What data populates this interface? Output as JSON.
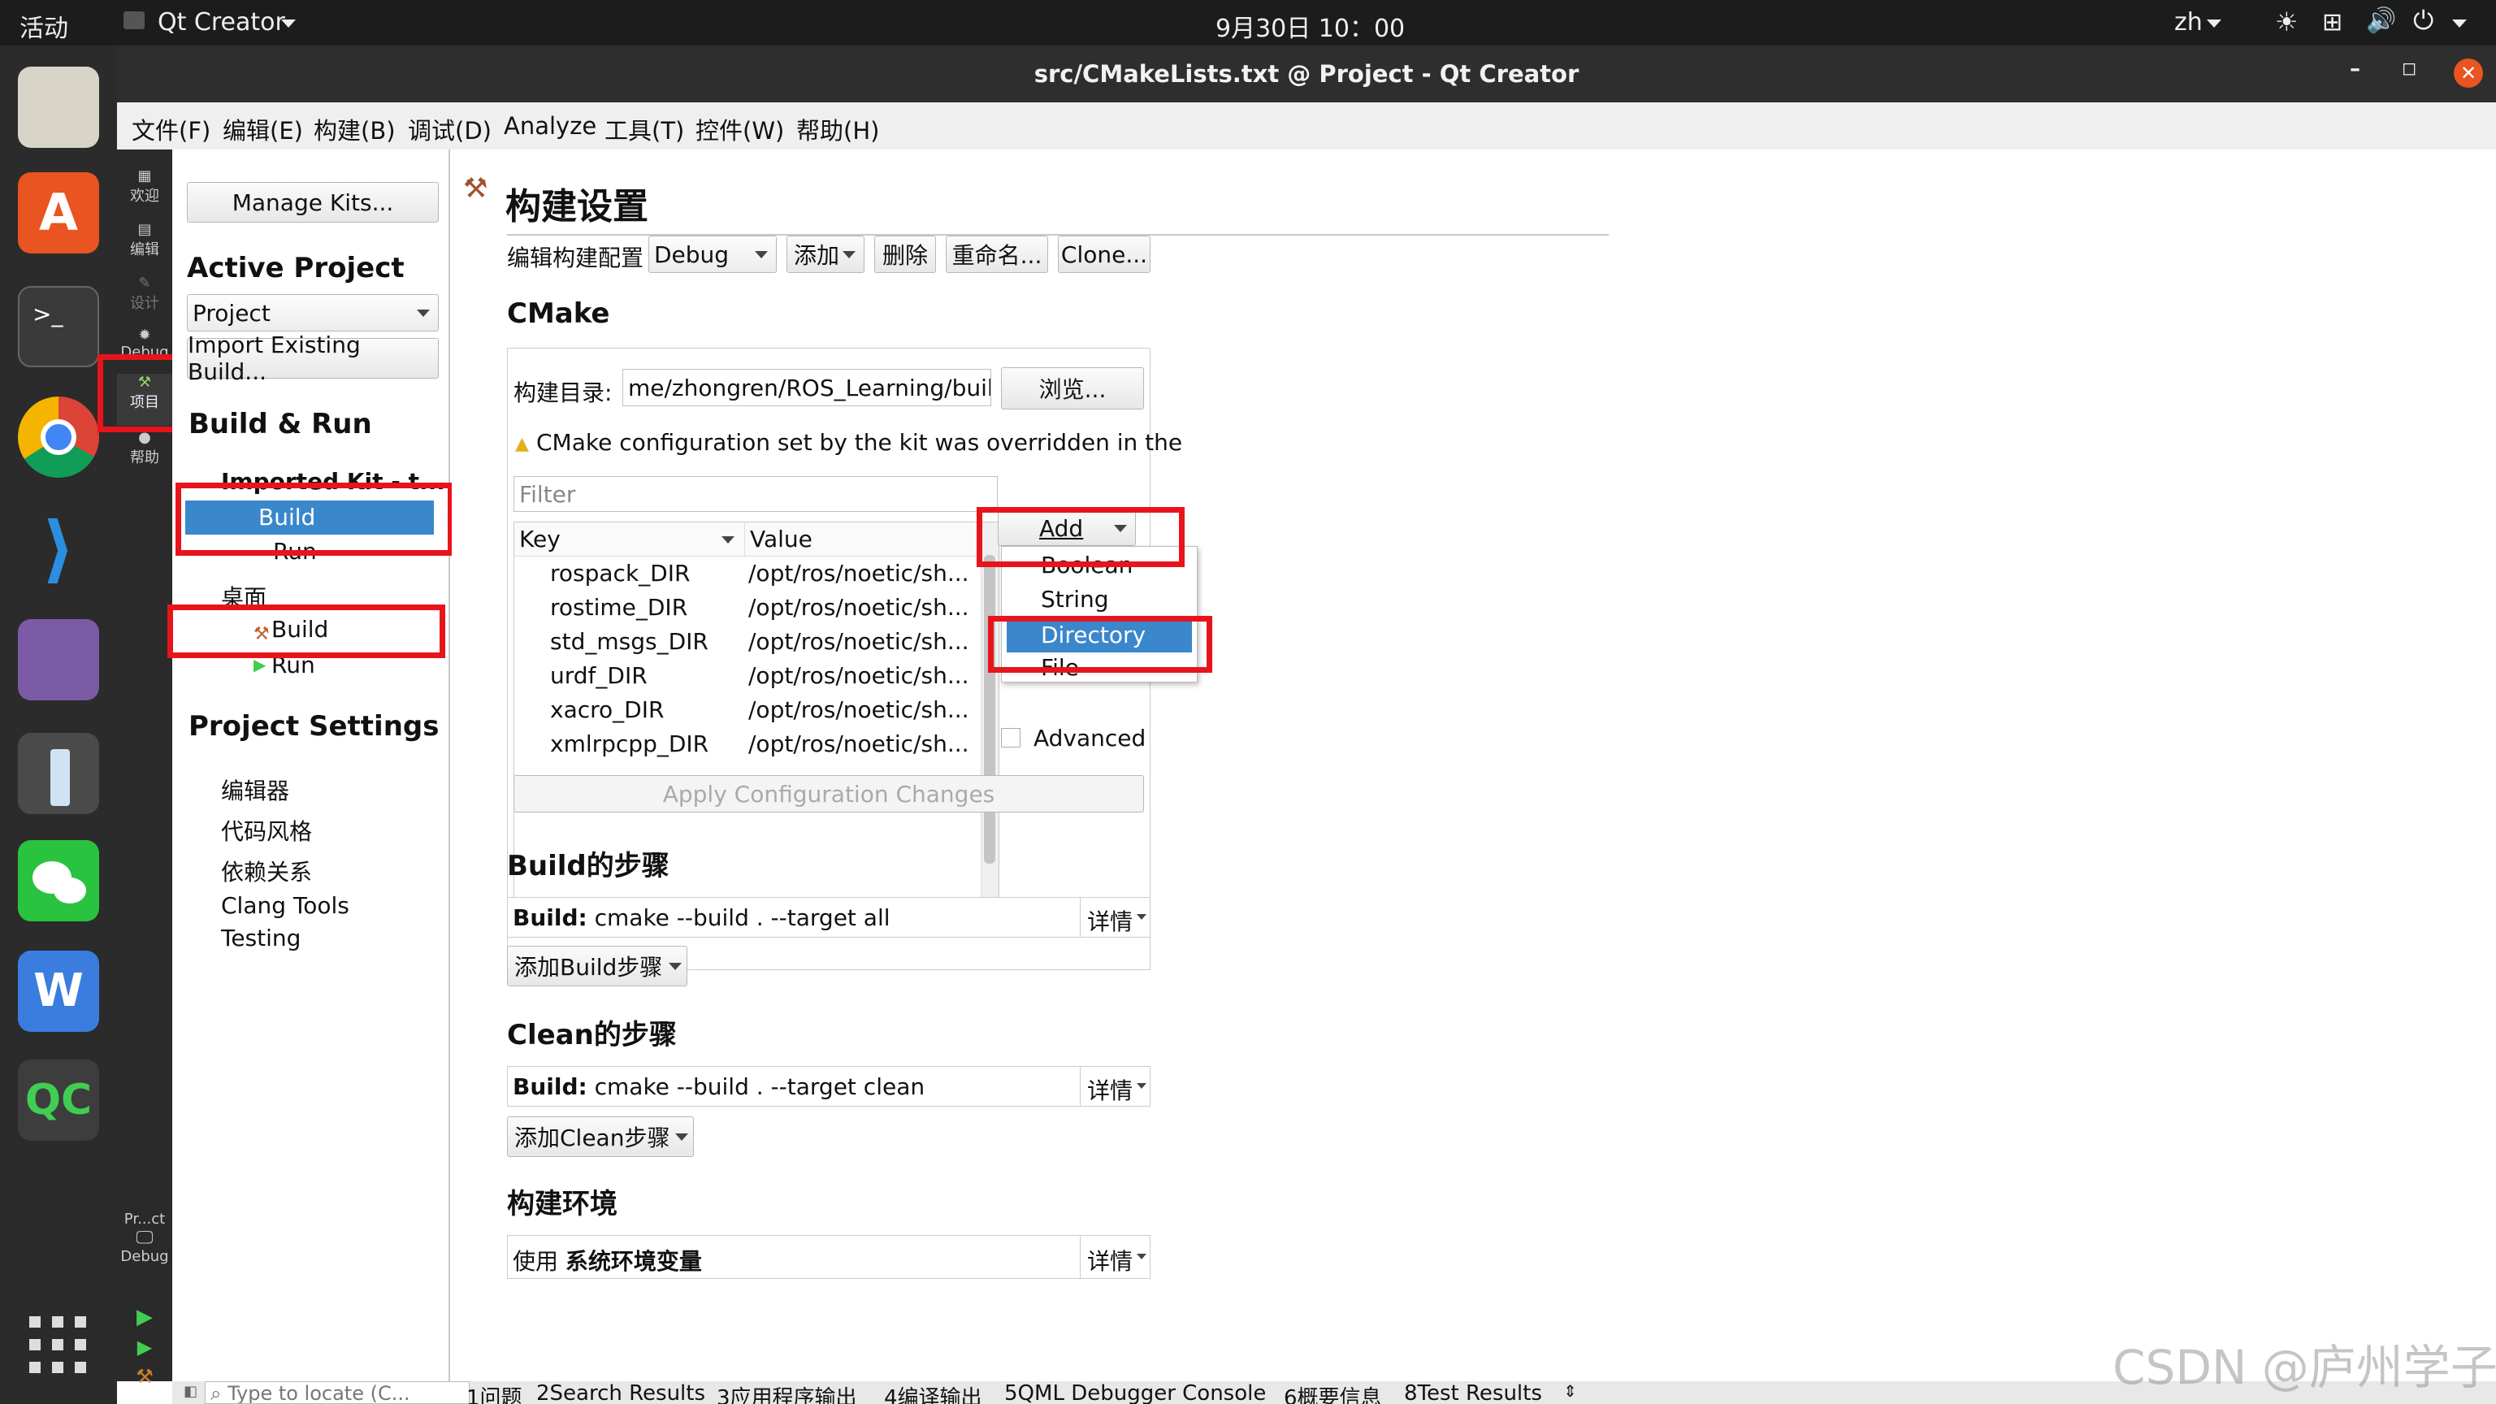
{
  "topbar": {
    "activities": "活动",
    "app_name": "Qt Creator",
    "clock": "9月30日 10：00",
    "lang": "zh"
  },
  "window": {
    "title": "src/CMakeLists.txt @ Project - Qt Creator"
  },
  "menu": [
    "文件(F)",
    "编辑(E)",
    "构建(B)",
    "调试(D)",
    "Analyze",
    "工具(T)",
    "控件(W)",
    "帮助(H)"
  ],
  "modes": {
    "welcome": "欢迎",
    "edit": "编辑",
    "design": "设计",
    "debug": "Debug",
    "projects": "项目",
    "help": "帮助",
    "kit_project": "Pr...ct",
    "kit_config": "Debug"
  },
  "left": {
    "manage_kits": "Manage Kits...",
    "active_project_heading": "Active Project",
    "project_select": "Project",
    "import_build": "Import Existing Build...",
    "build_run_heading": "Build & Run",
    "kit1_name": "Imported Kit - t...",
    "kit1_build": "Build",
    "kit1_run": "Run",
    "kit2_name": "桌面",
    "kit2_build": "Build",
    "kit2_run": "Run",
    "project_settings_heading": "Project Settings",
    "settings_items": [
      "编辑器",
      "代码风格",
      "依赖关系",
      "Clang Tools",
      "Testing"
    ]
  },
  "main": {
    "page_title": "构建设置",
    "edit_config_label": "编辑构建配置",
    "config_value": "Debug",
    "add_label": "添加",
    "delete_label": "删除",
    "rename_label": "重命名...",
    "clone_label": "Clone...",
    "cmake_heading": "CMake",
    "build_dir_label": "构建目录:",
    "build_dir_value": "me/zhongren/ROS_Learning/build",
    "browse_label": "浏览...",
    "warning_text": "CMake configuration set by the kit was overridden in the",
    "filter_placeholder": "Filter",
    "table_headers": {
      "key": "Key",
      "value": "Value"
    },
    "table_rows": [
      {
        "key": "rospack_DIR",
        "value": "/opt/ros/noetic/sh..."
      },
      {
        "key": "rostime_DIR",
        "value": "/opt/ros/noetic/sh..."
      },
      {
        "key": "std_msgs_DIR",
        "value": "/opt/ros/noetic/sh..."
      },
      {
        "key": "urdf_DIR",
        "value": "/opt/ros/noetic/sh..."
      },
      {
        "key": "xacro_DIR",
        "value": "/opt/ros/noetic/sh..."
      },
      {
        "key": "xmlrpcpp_DIR",
        "value": "/opt/ros/noetic/sh..."
      }
    ],
    "add_button": "Add",
    "add_menu": [
      "Boolean",
      "String",
      "Directory",
      "File"
    ],
    "advanced_label": "Advanced",
    "apply_label": "Apply Configuration Changes",
    "build_steps_heading": "Build的步骤",
    "build_step_bold": "Build:",
    "build_step_cmd": " cmake --build . --target all",
    "details_label": "详情",
    "add_build_step": "添加Build步骤",
    "clean_steps_heading": "Clean的步骤",
    "clean_step_bold": "Build:",
    "clean_step_cmd": " cmake --build . --target clean",
    "add_clean_step": "添加Clean步骤",
    "env_heading": "构建环境",
    "env_use": "使用 ",
    "env_value": "系统环境变量"
  },
  "statusbar": {
    "locate_placeholder": "Type to locate (C...",
    "tabs": [
      "1问题",
      "2Search Results",
      "3应用程序输出",
      "4编译输出",
      "5QML Debugger Console",
      "6概要信息",
      "8Test Results"
    ]
  },
  "watermark": "CSDN @庐州学子",
  "colors": {
    "selection": "#3a87cc",
    "highlight_box": "#e8141c"
  }
}
